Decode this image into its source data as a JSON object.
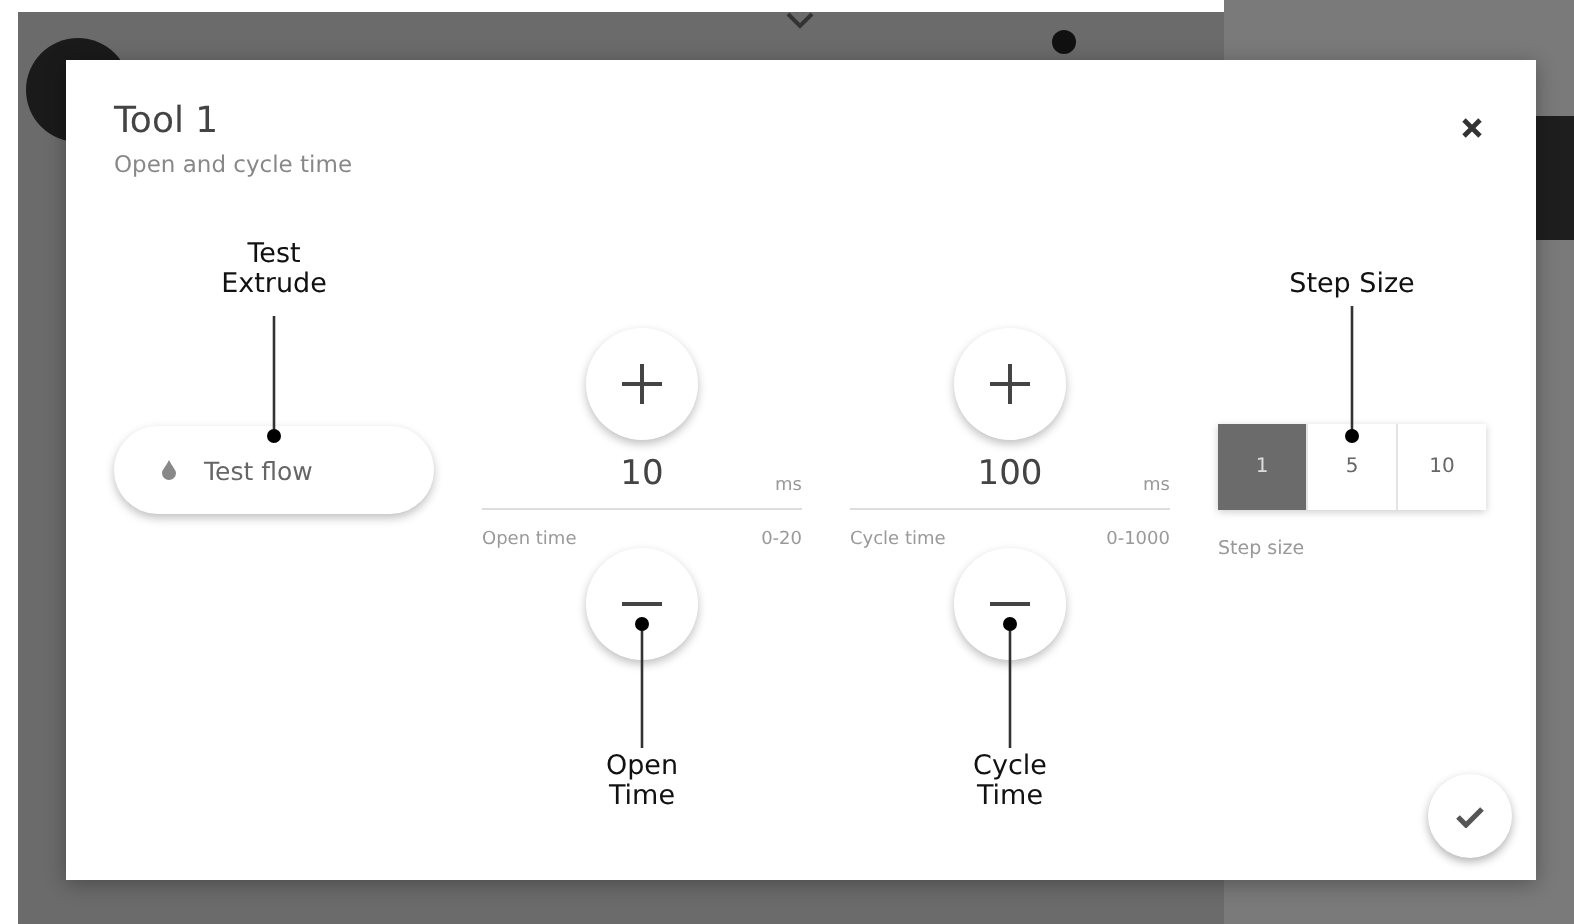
{
  "dialog": {
    "title": "Tool 1",
    "subtitle": "Open and cycle time",
    "test_button": {
      "label": "Test flow"
    },
    "steppers": [
      {
        "value": "10",
        "unit": "ms",
        "label": "Open time",
        "range": "0-20"
      },
      {
        "value": "100",
        "unit": "ms",
        "label": "Cycle time",
        "range": "0-1000"
      }
    ],
    "step_size": {
      "label": "Step size",
      "options": [
        {
          "label": "1",
          "selected": true
        },
        {
          "label": "5",
          "selected": false
        },
        {
          "label": "10",
          "selected": false
        }
      ]
    }
  },
  "annotations": [
    {
      "text": "Test Extrude",
      "wrap": true
    },
    {
      "text": "Open Time",
      "wrap": true
    },
    {
      "text": "Cycle Time",
      "wrap": true
    },
    {
      "text": "Step Size",
      "wrap": false
    }
  ]
}
